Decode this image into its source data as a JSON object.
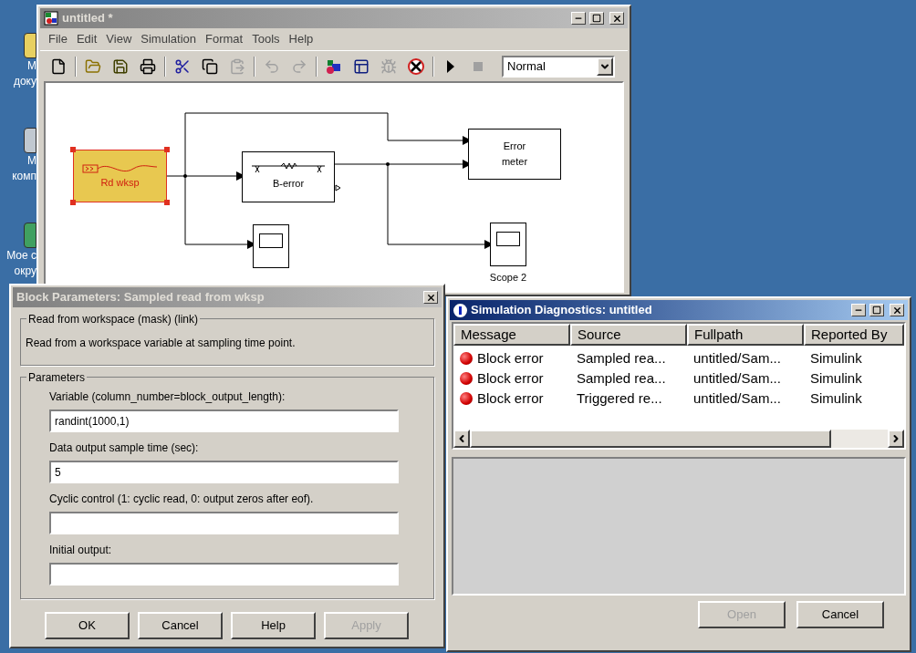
{
  "desktop_icons": [
    {
      "kind": "folder",
      "lines": [
        "М",
        "доку"
      ]
    },
    {
      "kind": "computer",
      "lines": [
        "М",
        "комп"
      ]
    },
    {
      "kind": "network",
      "lines": [
        "Мое с",
        "окру"
      ]
    }
  ],
  "simulink": {
    "title": "untitled *",
    "active": false,
    "menu": [
      "File",
      "Edit",
      "View",
      "Simulation",
      "Format",
      "Tools",
      "Help"
    ],
    "toolbar": [
      {
        "kind": "new",
        "disabled": false
      },
      {
        "kind": "separator"
      },
      {
        "kind": "open",
        "disabled": false
      },
      {
        "kind": "save",
        "disabled": false
      },
      {
        "kind": "print",
        "disabled": false
      },
      {
        "kind": "separator"
      },
      {
        "kind": "cut",
        "disabled": false
      },
      {
        "kind": "copy",
        "disabled": false
      },
      {
        "kind": "paste",
        "disabled": true
      },
      {
        "kind": "separator"
      },
      {
        "kind": "undo",
        "disabled": true
      },
      {
        "kind": "redo",
        "disabled": true
      },
      {
        "kind": "separator"
      },
      {
        "kind": "library",
        "disabled": false
      },
      {
        "kind": "explorer",
        "disabled": false
      },
      {
        "kind": "debug",
        "disabled": true
      },
      {
        "kind": "build",
        "disabled": false
      },
      {
        "kind": "separator"
      },
      {
        "kind": "start",
        "disabled": false
      },
      {
        "kind": "stop",
        "disabled": true
      }
    ],
    "mode": "Normal",
    "diagram": {
      "blocks": [
        {
          "kind": "source",
          "label": "Rd wksp",
          "selected": true
        },
        {
          "kind": "subsystem",
          "label": "B-error",
          "selected": false
        },
        {
          "kind": "meter",
          "label": "Error meter",
          "selected": false
        },
        {
          "kind": "scope",
          "selected": false
        },
        {
          "kind": "scope",
          "label": "Scope 2",
          "selected": false
        }
      ]
    }
  },
  "block_parameters": {
    "title": "Block Parameters: Sampled read from wksp",
    "active": false,
    "description_group": {
      "title": "Read from workspace (mask) (link)",
      "text": "Read from a workspace variable at sampling time point."
    },
    "parameters_group": {
      "title": "Parameters",
      "fields": [
        {
          "label": "Variable (column_number=block_output_length):",
          "value": "randint(1000,1)"
        },
        {
          "label": "Data output sample time (sec):",
          "value": "5"
        },
        {
          "label": "Cyclic control (1: cyclic read, 0: output zeros after eof)."
        },
        {
          "label": "Initial output:"
        }
      ]
    },
    "buttons": [
      {
        "label": "OK",
        "disabled": false
      },
      {
        "label": "Cancel",
        "disabled": false
      },
      {
        "label": "Help",
        "disabled": false
      },
      {
        "label": "Apply",
        "disabled": true
      }
    ]
  },
  "diagnostics": {
    "title": "Simulation Diagnostics: untitled",
    "active": true,
    "columns": [
      "Message",
      "Source",
      "Fullpath",
      "Reported By"
    ],
    "rows": [
      {
        "kind": "error",
        "cells": [
          "Block error",
          "Sampled rea...",
          "untitled/Sam...",
          "Simulink"
        ]
      },
      {
        "kind": "error",
        "cells": [
          "Block error",
          "Sampled rea...",
          "untitled/Sam...",
          "Simulink"
        ]
      },
      {
        "kind": "error",
        "cells": [
          "Block error",
          "Triggered re...",
          "untitled/Sam...",
          "Simulink"
        ]
      }
    ],
    "buttons": [
      {
        "label": "Open",
        "disabled": true
      },
      {
        "label": "Cancel",
        "disabled": false
      }
    ]
  }
}
